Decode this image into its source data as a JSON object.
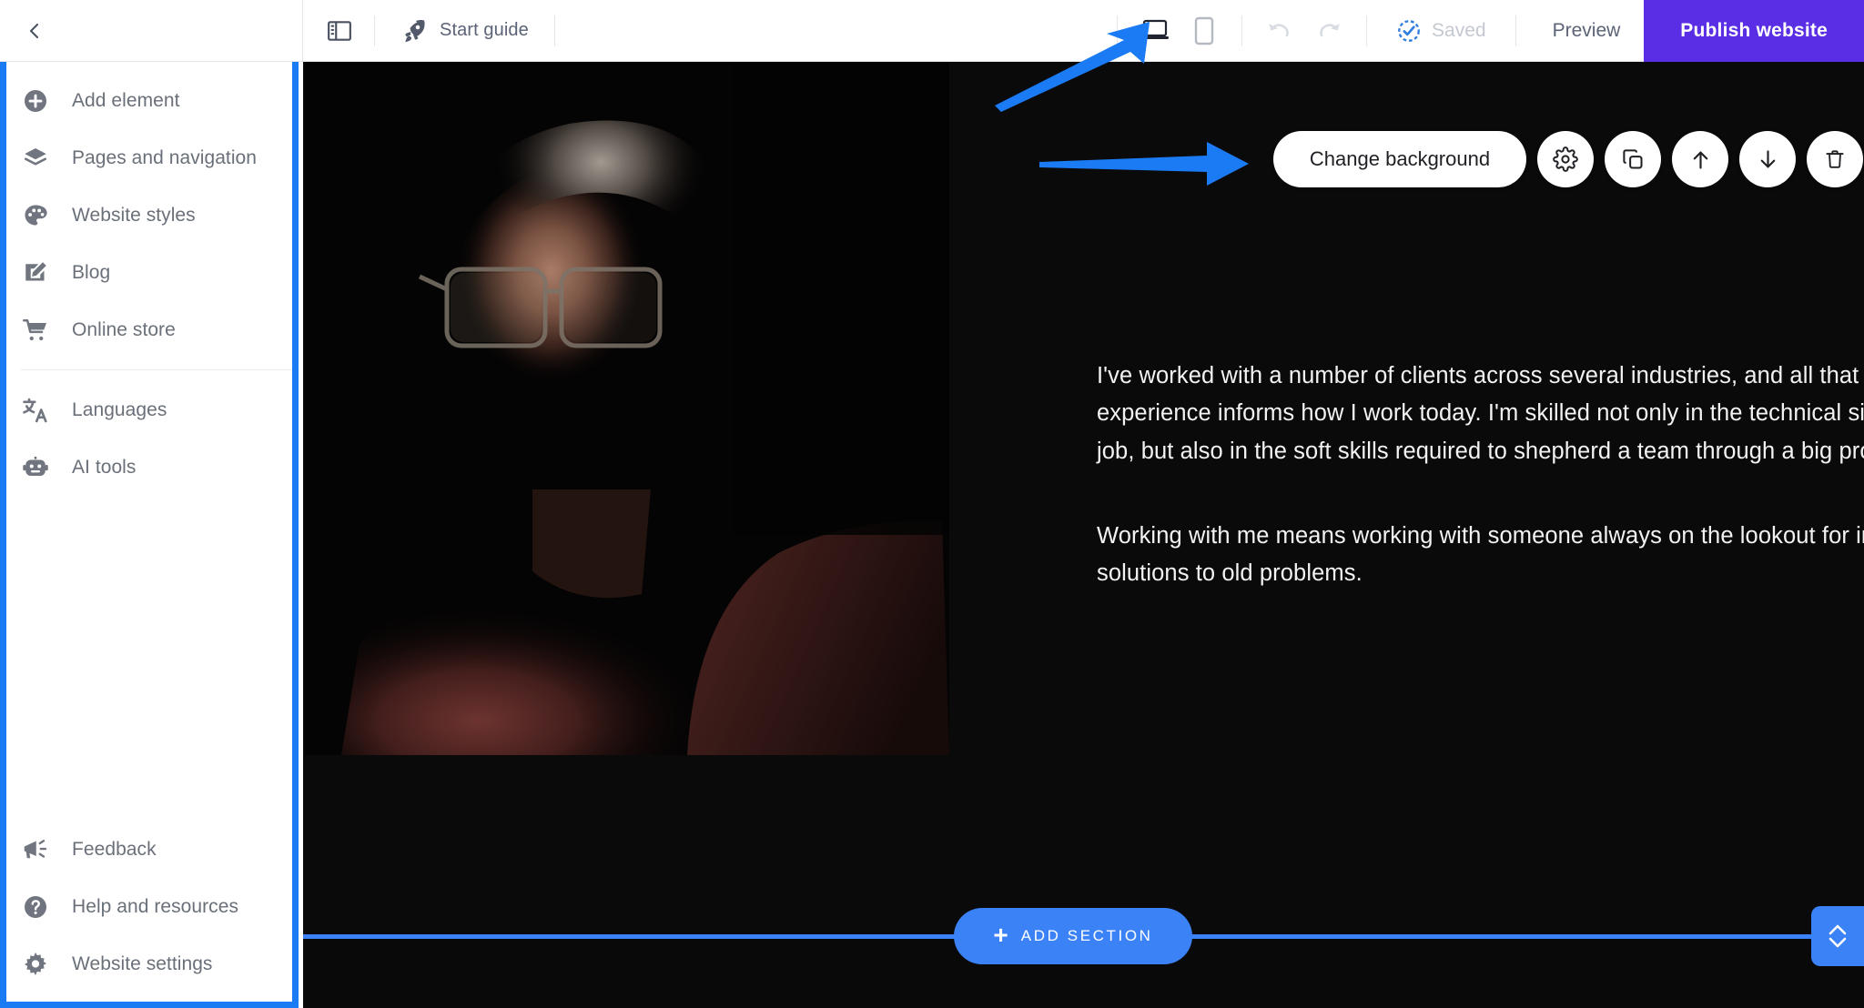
{
  "colors": {
    "accent_blue": "#3b82f6",
    "highlight_blue": "#1a7bf5",
    "publish_purple": "#5a2ee5",
    "sidebar_text": "#6a7079",
    "canvas_bg": "#0a0a0a"
  },
  "topbar": {
    "back_icon": "chevron-left-icon",
    "panel_toggle_icon": "sidebar-panel-icon",
    "start_guide": {
      "label": "Start guide",
      "icon": "rocket-icon"
    },
    "devices": [
      {
        "name": "desktop",
        "icon": "laptop-icon",
        "active": true
      },
      {
        "name": "mobile",
        "icon": "mobile-phone-icon",
        "active": false
      }
    ],
    "history": [
      {
        "name": "undo",
        "icon": "undo-arrow-icon"
      },
      {
        "name": "redo",
        "icon": "redo-arrow-icon"
      }
    ],
    "saved": {
      "label": "Saved",
      "icon": "check-circle-icon"
    },
    "preview_label": "Preview",
    "publish_label": "Publish website"
  },
  "sidebar": {
    "items_top": [
      {
        "label": "Add element",
        "icon": "plus-circle-icon"
      },
      {
        "label": "Pages and navigation",
        "icon": "layers-icon"
      },
      {
        "label": "Website styles",
        "icon": "palette-icon"
      },
      {
        "label": "Blog",
        "icon": "edit-square-icon"
      },
      {
        "label": "Online store",
        "icon": "shopping-cart-icon"
      }
    ],
    "items_mid": [
      {
        "label": "Languages",
        "icon": "translate-icon"
      },
      {
        "label": "AI tools",
        "icon": "robot-icon"
      }
    ],
    "items_bottom": [
      {
        "label": "Feedback",
        "icon": "megaphone-icon"
      },
      {
        "label": "Help and resources",
        "icon": "question-circle-icon"
      },
      {
        "label": "Website settings",
        "icon": "gear-icon"
      }
    ]
  },
  "section_toolbar": {
    "change_background_label": "Change background",
    "buttons": [
      {
        "name": "section-settings",
        "icon": "gear-icon"
      },
      {
        "name": "duplicate-section",
        "icon": "copy-icon"
      },
      {
        "name": "move-section-up",
        "icon": "arrow-up-icon"
      },
      {
        "name": "move-section-down",
        "icon": "arrow-down-icon"
      },
      {
        "name": "delete-section",
        "icon": "trash-icon"
      }
    ]
  },
  "canvas": {
    "hero": {
      "image_alt": "portrait-photo-man-with-glasses-dark-background",
      "paragraphs": [
        "I've worked with a number of clients across several industries, and all that experience informs how I work today. I'm skilled not only in the technical side of my job, but also in the soft skills required to shepherd a team through a big project.",
        "Working with me means working with someone always on the lookout for innovative solutions to old problems."
      ],
      "paragraph_lines": [
        "I've worked with a number of clients across several industries, and all that",
        "experience informs how I work today. I'm skilled not only in the technical side of my",
        "job, but also in the soft skills required to shepherd a team through a big project.",
        "Working with me means working with someone always on the lookout for innovative",
        "solutions to old problems."
      ]
    },
    "add_section": {
      "label": "ADD SECTION",
      "plus": "+"
    },
    "resize_handle": {
      "icon": "chevron-up-down-icon"
    }
  },
  "annotations": [
    {
      "name": "arrow-to-device-switcher",
      "color": "#1a7bf5"
    },
    {
      "name": "arrow-to-change-background",
      "color": "#1a7bf5"
    }
  ]
}
